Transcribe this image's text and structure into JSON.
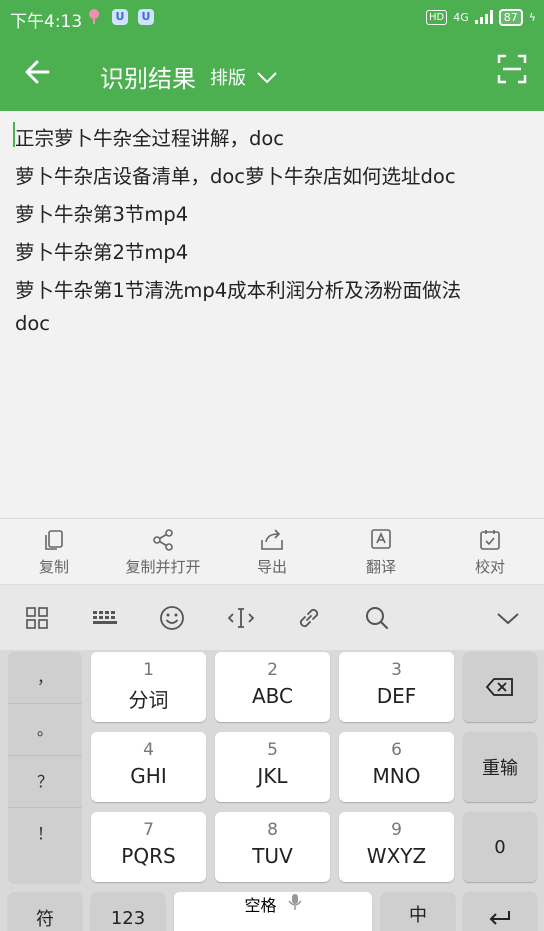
{
  "status_bar": {
    "time": "下午4:13",
    "hd": "HD",
    "network": "4G",
    "battery": "87"
  },
  "app_bar": {
    "title": "识别结果",
    "layout_label": "排版"
  },
  "result_lines": [
    "正宗萝卜牛杂全过程讲解，doc",
    "萝卜牛杂店设备清单，doc萝卜牛杂店如何选址doc",
    "萝卜牛杂第3节mp4",
    "萝卜牛杂第2节mp4",
    "萝卜牛杂第1节清洗mp4成本利润分析及汤粉面做法",
    "doc"
  ],
  "actions": [
    {
      "label": "复制",
      "icon": "copy-icon"
    },
    {
      "label": "复制并打开",
      "icon": "share-icon"
    },
    {
      "label": "导出",
      "icon": "export-icon"
    },
    {
      "label": "翻译",
      "icon": "translate-icon"
    },
    {
      "label": "校对",
      "icon": "proofread-icon"
    }
  ],
  "keyboard": {
    "toolbar_icons": [
      "grid-icon",
      "keyboard-icon",
      "emoji-icon",
      "cursor-icon",
      "link-icon",
      "search-icon",
      "chevron-down-icon"
    ],
    "symbols": [
      "，",
      "。",
      "？",
      "！"
    ],
    "keys": [
      {
        "num": "1",
        "text": "分词"
      },
      {
        "num": "2",
        "text": "ABC"
      },
      {
        "num": "3",
        "text": "DEF"
      },
      {
        "num": "4",
        "text": "GHI"
      },
      {
        "num": "5",
        "text": "JKL"
      },
      {
        "num": "6",
        "text": "MNO"
      },
      {
        "num": "7",
        "text": "PQRS"
      },
      {
        "num": "8",
        "text": "TUV"
      },
      {
        "num": "9",
        "text": "WXYZ"
      }
    ],
    "reenter": "重输",
    "zero": "0",
    "symbol_key": "符",
    "num_key": "123",
    "space_key": "空格",
    "lang_key": "中"
  }
}
